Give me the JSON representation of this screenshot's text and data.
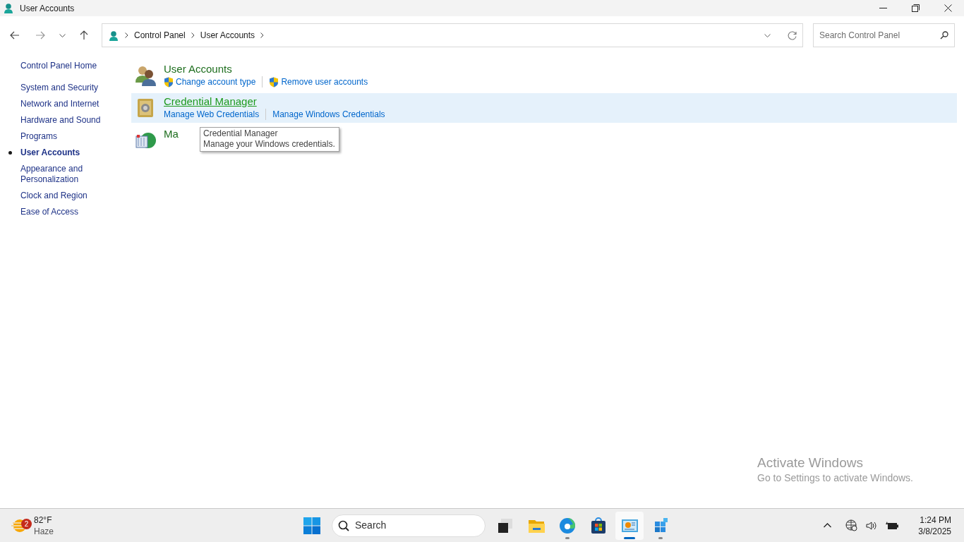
{
  "window": {
    "title": "User Accounts"
  },
  "address": {
    "crumbs": [
      "Control Panel",
      "User Accounts"
    ]
  },
  "search": {
    "placeholder": "Search Control Panel"
  },
  "sidebar": {
    "home": "Control Panel Home",
    "items": [
      {
        "label": "System and Security",
        "selected": false
      },
      {
        "label": "Network and Internet",
        "selected": false
      },
      {
        "label": "Hardware and Sound",
        "selected": false
      },
      {
        "label": "Programs",
        "selected": false
      },
      {
        "label": "User Accounts",
        "selected": true
      },
      {
        "label": "Appearance and Personalization",
        "selected": false
      },
      {
        "label": "Clock and Region",
        "selected": false
      },
      {
        "label": "Ease of Access",
        "selected": false
      }
    ]
  },
  "categories": [
    {
      "kind": "users",
      "title": "User Accounts",
      "hovered": false,
      "links": [
        {
          "label": "Change account type",
          "shield": true
        },
        {
          "label": "Remove user accounts",
          "shield": true
        }
      ]
    },
    {
      "kind": "vault",
      "title": "Credential Manager",
      "hovered": true,
      "links": [
        {
          "label": "Manage Web Credentials",
          "shield": false
        },
        {
          "label": "Manage Windows Credentials",
          "shield": false
        }
      ]
    },
    {
      "kind": "mail",
      "title": "Ma",
      "hovered": false
    }
  ],
  "tooltip": {
    "title": "Credential Manager",
    "text": "Manage your Windows credentials."
  },
  "activation": {
    "title": "Activate Windows",
    "text": "Go to Settings to activate Windows."
  },
  "taskbar": {
    "weather": {
      "badge": "2",
      "temp": "82°F",
      "condition": "Haze"
    },
    "search": "Search",
    "apps": [
      {
        "kind": "taskview",
        "running": false,
        "active": false
      },
      {
        "kind": "folder",
        "running": false,
        "active": false
      },
      {
        "kind": "edge",
        "running": true,
        "active": false
      },
      {
        "kind": "store",
        "running": false,
        "active": false
      },
      {
        "kind": "panel",
        "running": true,
        "active": true
      },
      {
        "kind": "cubes",
        "running": true,
        "active": false
      }
    ],
    "time": "1:24 PM",
    "date": "3/8/2025"
  }
}
